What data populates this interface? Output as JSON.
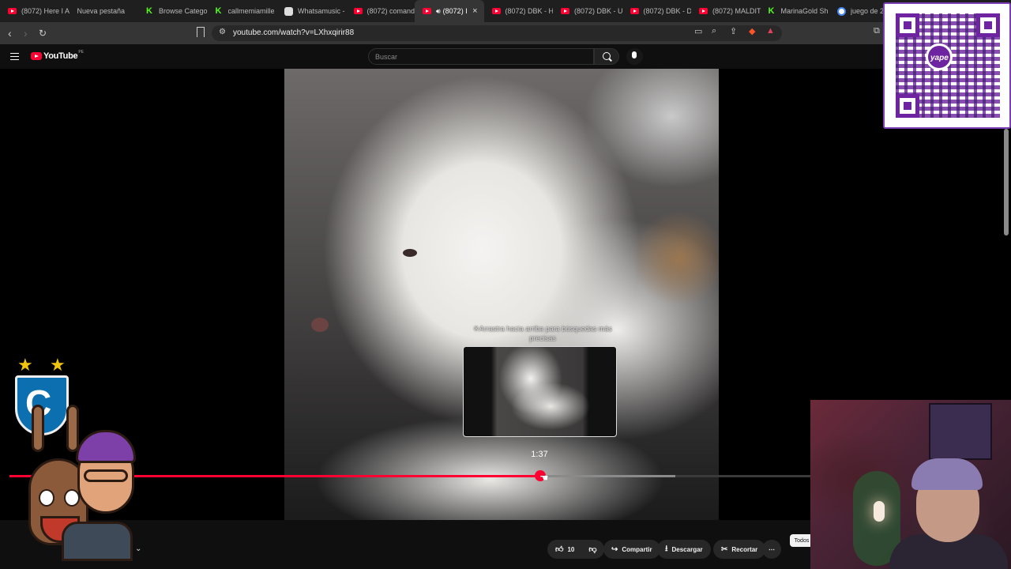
{
  "browser": {
    "tabs": [
      {
        "title": "(8072) Here I A",
        "favicon": "youtube"
      },
      {
        "title": "Nueva pestaña",
        "favicon": "none"
      },
      {
        "title": "Browse Catego",
        "favicon": "kick"
      },
      {
        "title": "callmemiamille",
        "favicon": "kick"
      },
      {
        "title": "Whatsamusic -",
        "favicon": "whatsamusic"
      },
      {
        "title": "(8072) comand",
        "favicon": "youtube"
      },
      {
        "title": "(8072) I",
        "favicon": "youtube",
        "active": true,
        "audio_icon": "speaker-icon"
      },
      {
        "title": "(8072) DBK - H",
        "favicon": "youtube"
      },
      {
        "title": "(8072) DBK - U",
        "favicon": "youtube"
      },
      {
        "title": "(8072) DBK - D",
        "favicon": "youtube"
      },
      {
        "title": "(8072) MALDIT",
        "favicon": "youtube"
      },
      {
        "title": "MarinaGold Sh",
        "favicon": "kick"
      },
      {
        "title": "juego de 2",
        "favicon": "google"
      }
    ],
    "tab_close": "×",
    "url": "youtube.com/watch?v=LXhxqirir88"
  },
  "youtube": {
    "logo_text": "YouTube",
    "country_code": "PE",
    "search_placeholder": "Buscar"
  },
  "player": {
    "drag_hint": "※Arrastra hacia arriba para búsquedas más precisas",
    "hover_time": "1:37",
    "played_fraction": 0.664,
    "buffered_fraction": 0.831
  },
  "actions": {
    "like_count": "10",
    "share_label": "Compartir",
    "download_label": "Descargar",
    "clip_label": "Recortar",
    "more_label": "⋯",
    "filter_chip": "Todos"
  },
  "overlays": {
    "qr_brand": "yape",
    "club_letter": "C",
    "colors": {
      "qr_purple": "#6e24a0",
      "club_blue": "#0b6fb0",
      "progress_red": "#ff0033"
    }
  }
}
